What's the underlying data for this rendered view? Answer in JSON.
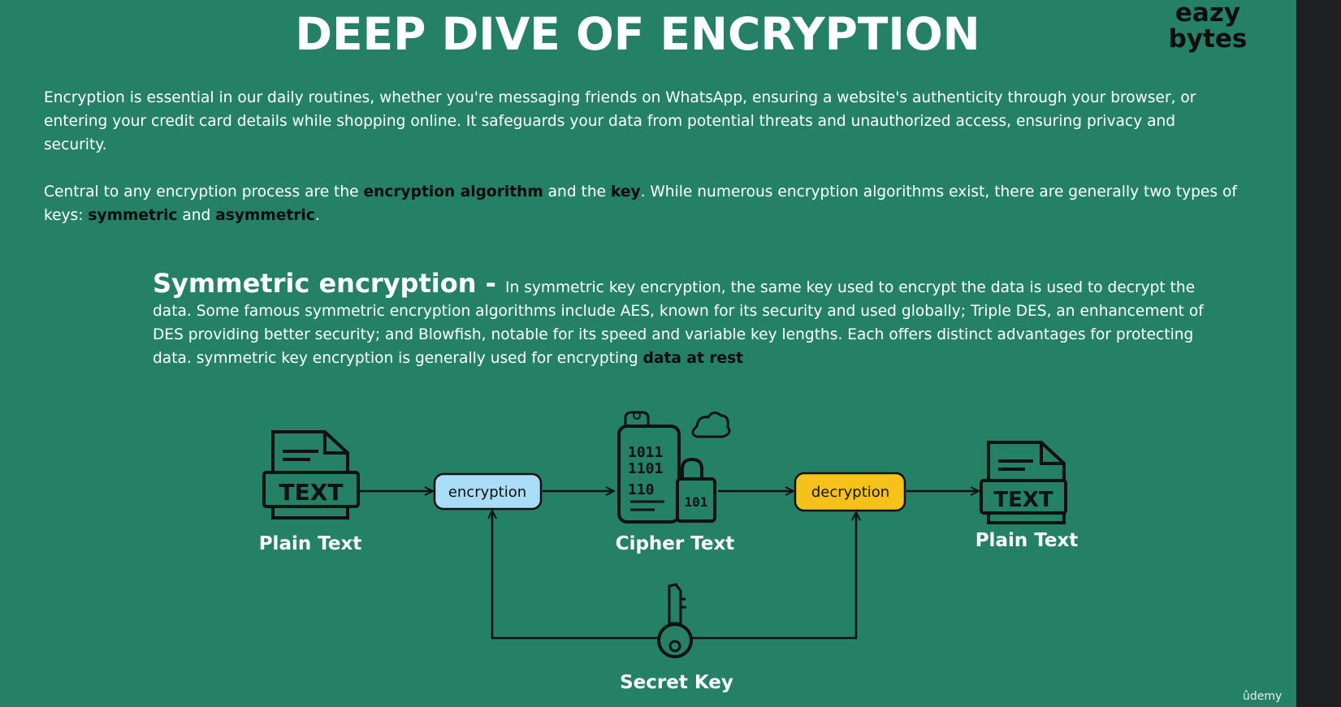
{
  "slide": {
    "title": "DEEP DIVE OF ENCRYPTION",
    "logo": {
      "line1": "eazy",
      "line2": "bytes"
    },
    "intro": "Encryption is essential in our daily routines, whether you're messaging friends on WhatsApp, ensuring a website's authenticity through your browser, or entering your credit card details while shopping online. It safeguards your data from potential threats and unauthorized access, ensuring privacy and security.",
    "central": {
      "pre": "Central to any encryption process are the ",
      "term1": "encryption algorithm",
      "mid1": " and the ",
      "term2": "key",
      "mid2": ". While numerous encryption algorithms exist, there are generally two types of keys: ",
      "term3": "symmetric",
      "mid3": " and ",
      "term4": "asymmetric",
      "end": "."
    },
    "symmetric": {
      "heading": "Symmetric encryption - ",
      "body": "In symmetric key encryption, the same key used to encrypt the data is used to decrypt the data. Some famous symmetric encryption algorithms include AES, known for its security and used globally; Triple DES, an enhancement of DES providing better security; and Blowfish, notable for its speed and variable key lengths. Each offers distinct advantages for protecting data. symmetric key encryption is generally used for encrypting ",
      "emphasis": "data at rest"
    },
    "diagram": {
      "plain_text_left": "Plain Text",
      "doc_word": "TEXT",
      "encryption": "encryption",
      "cipher_text": "Cipher Text",
      "decryption": "decryption",
      "plain_text_right": "Plain Text",
      "secret_key": "Secret Key",
      "cipher_digits": [
        "1011",
        "1101",
        "110",
        "101"
      ],
      "colors": {
        "encryption_pill": "#a9dcf7",
        "decryption_pill": "#f6c21a",
        "line": "#111111",
        "accent": "#f0d23c"
      }
    },
    "watermark": "ûdemy"
  }
}
